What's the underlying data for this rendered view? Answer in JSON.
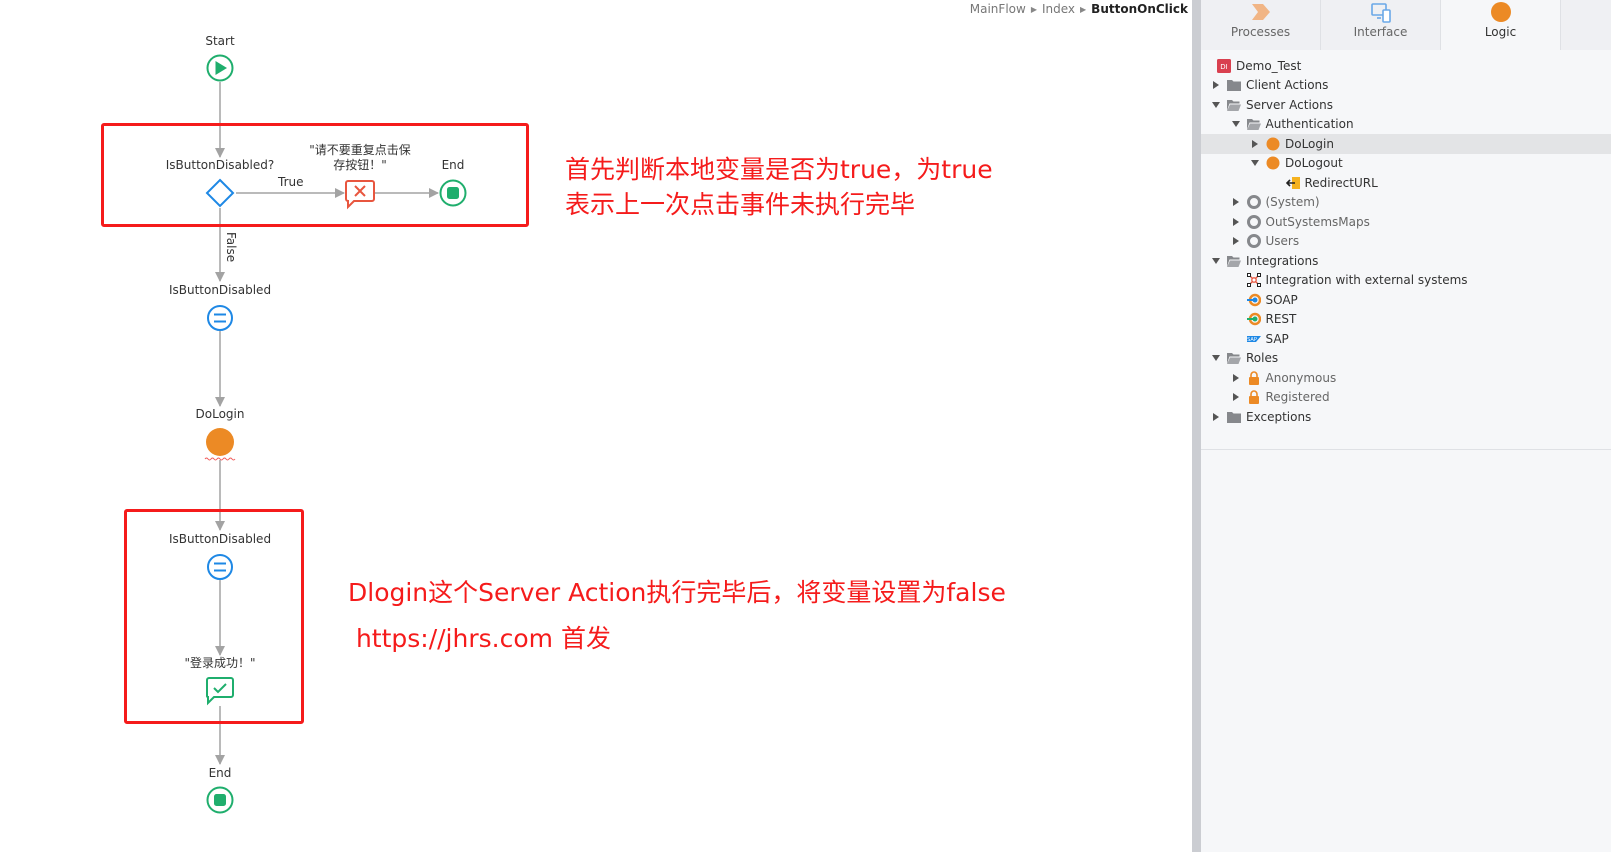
{
  "breadcrumb": {
    "items": [
      "MainFlow",
      "Index"
    ],
    "current": "ButtonOnClick"
  },
  "flow": {
    "start_label": "Start",
    "if_label": "IsButtonDisabled?",
    "true_label": "True",
    "false_label": "False",
    "error_message_label_line1": "\"请不要重复点击保",
    "error_message_label_line2": "存按钮！\"",
    "end_label_top": "End",
    "assign1_label": "IsButtonDisabled",
    "action_label": "DoLogin",
    "assign2_label": "IsButtonDisabled",
    "success_message_label": "\"登录成功！\"",
    "end_label_bottom": "End"
  },
  "annotations": {
    "top_line1": "首先判断本地变量是否为true，为true",
    "top_line2": "表示上一次点击事件未执行完毕",
    "bottom_line1": "Dlogin这个Server Action执行完毕后，将变量设置为false",
    "bottom_line2": " https://jhrs.com 首发"
  },
  "colors": {
    "annotation_red": "#f51b1b",
    "start_end_green": "#1fae6d",
    "assign_blue": "#1e88e5",
    "action_orange": "#ec8a25",
    "error_red": "#e8563f"
  },
  "panel": {
    "tabs": [
      {
        "label": "Processes",
        "icon": "processes-icon",
        "active": false
      },
      {
        "label": "Interface",
        "icon": "interface-icon",
        "active": false
      },
      {
        "label": "Logic",
        "icon": "logic-icon",
        "active": true
      }
    ],
    "tree": [
      {
        "label": "Demo_Test",
        "icon": "module-icon",
        "level": 0,
        "caret": "none"
      },
      {
        "label": "Client Actions",
        "icon": "folder-icon",
        "level": 0,
        "caret": "collapsed"
      },
      {
        "label": "Server Actions",
        "icon": "folder-open-icon",
        "level": 0,
        "caret": "expanded"
      },
      {
        "label": "Authentication",
        "icon": "folder-open-icon",
        "level": 1,
        "caret": "expanded"
      },
      {
        "label": "DoLogin",
        "icon": "action-icon",
        "level": 2,
        "caret": "collapsed",
        "selected": true
      },
      {
        "label": "DoLogout",
        "icon": "action-icon",
        "level": 2,
        "caret": "expanded"
      },
      {
        "label": "RedirectURL",
        "icon": "input-parameter-icon",
        "level": 3,
        "caret": "none"
      },
      {
        "label": "(System)",
        "icon": "reference-icon",
        "level": 1,
        "caret": "collapsed",
        "muted": true
      },
      {
        "label": "OutSystemsMaps",
        "icon": "reference-icon",
        "level": 1,
        "caret": "collapsed",
        "muted": true
      },
      {
        "label": "Users",
        "icon": "reference-icon",
        "level": 1,
        "caret": "collapsed",
        "muted": true
      },
      {
        "label": "Integrations",
        "icon": "folder-open-icon",
        "level": 0,
        "caret": "expanded"
      },
      {
        "label": "Integration with external systems",
        "icon": "integration-icon",
        "level": 1,
        "caret": "none"
      },
      {
        "label": "SOAP",
        "icon": "soap-icon",
        "level": 1,
        "caret": "none"
      },
      {
        "label": "REST",
        "icon": "rest-icon",
        "level": 1,
        "caret": "none"
      },
      {
        "label": "SAP",
        "icon": "sap-icon",
        "level": 1,
        "caret": "none"
      },
      {
        "label": "Roles",
        "icon": "folder-open-icon",
        "level": 0,
        "caret": "expanded"
      },
      {
        "label": "Anonymous",
        "icon": "role-lock-icon",
        "level": 1,
        "caret": "collapsed",
        "muted": true
      },
      {
        "label": "Registered",
        "icon": "role-lock-icon",
        "level": 1,
        "caret": "collapsed",
        "muted": true
      },
      {
        "label": "Exceptions",
        "icon": "folder-icon",
        "level": 0,
        "caret": "collapsed"
      }
    ]
  }
}
